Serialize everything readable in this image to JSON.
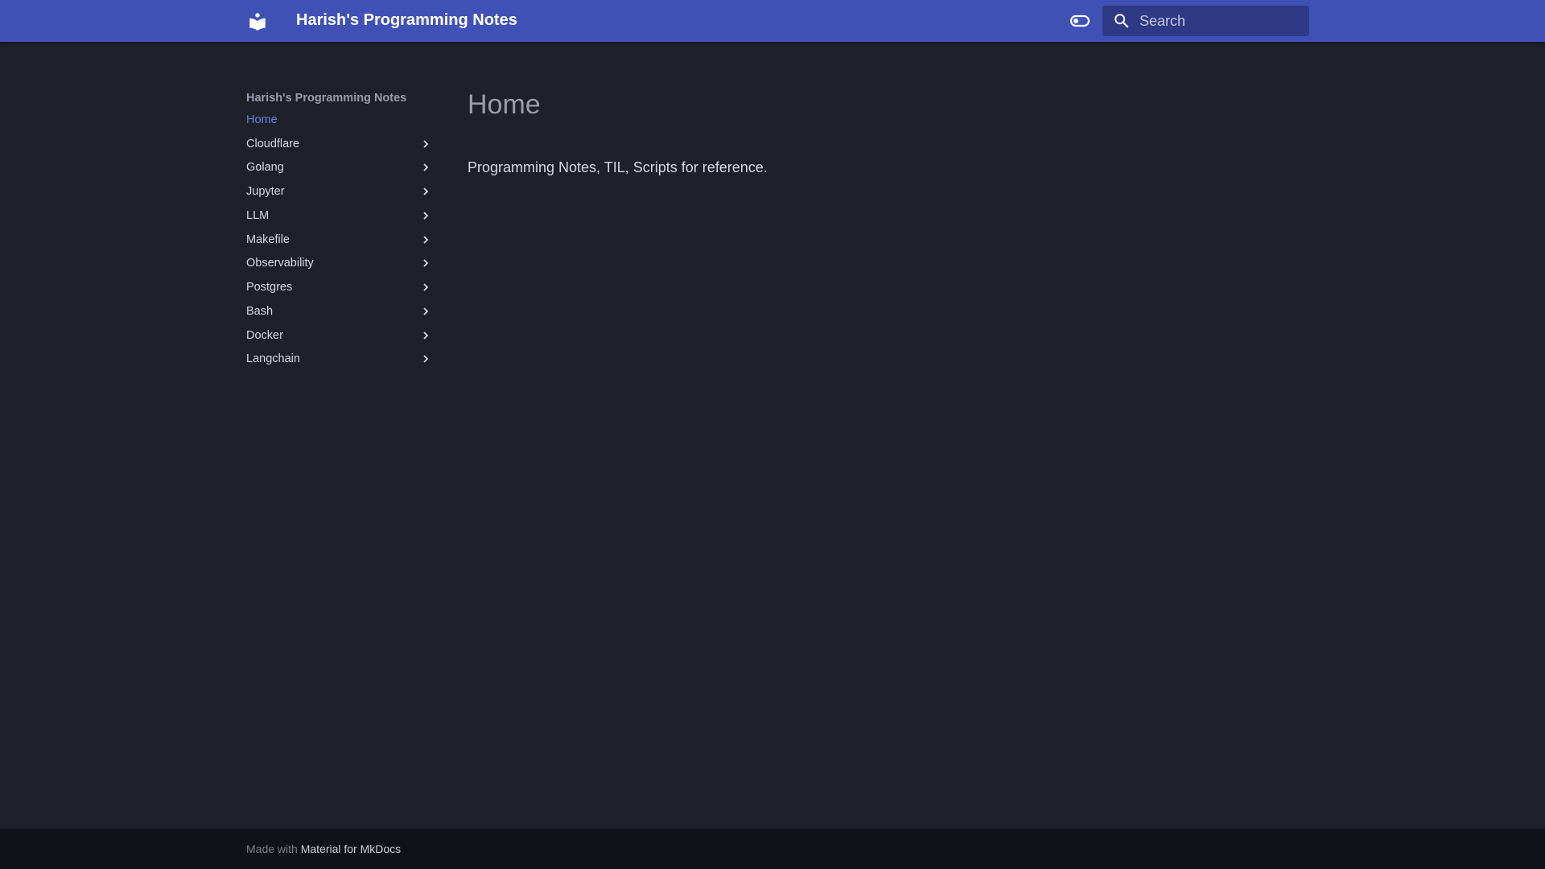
{
  "header": {
    "title": "Harish's Programming Notes",
    "logo_icon": "book-reader-icon",
    "toggle_icon": "theme-toggle-icon",
    "search_placeholder": "Search"
  },
  "sidebar": {
    "title": "Harish's Programming Notes",
    "items": [
      {
        "label": "Home",
        "active": true
      },
      {
        "label": "Cloudflare"
      },
      {
        "label": "Golang"
      },
      {
        "label": "Jupyter"
      },
      {
        "label": "LLM"
      },
      {
        "label": "Makefile"
      },
      {
        "label": "Observability"
      },
      {
        "label": "Postgres"
      },
      {
        "label": "Bash"
      },
      {
        "label": "Docker"
      },
      {
        "label": "Langchain"
      }
    ]
  },
  "content": {
    "heading": "Home",
    "paragraph": "Programming Notes, TIL, Scripts for reference."
  },
  "footer": {
    "prefix": "Made with",
    "link": "Material for MkDocs"
  },
  "colors": {
    "header": "#4051b5",
    "background": "#1e2129",
    "accent": "#5d80e8",
    "footer": "#111217"
  }
}
